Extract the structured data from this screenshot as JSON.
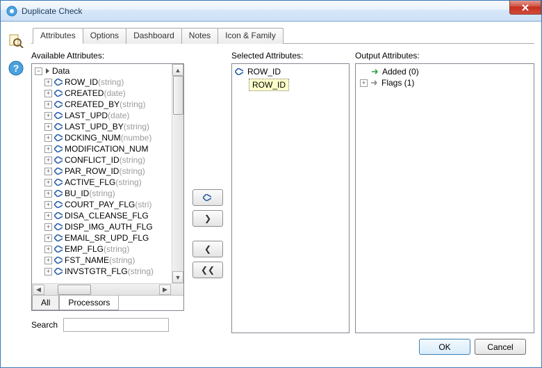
{
  "window": {
    "title": "Duplicate Check"
  },
  "tabs": [
    "Attributes",
    "Options",
    "Dashboard",
    "Notes",
    "Icon & Family"
  ],
  "active_tab": 0,
  "labels": {
    "available": "Available Attributes:",
    "selected": "Selected Attributes:",
    "output": "Output Attributes:",
    "search": "Search"
  },
  "tree_root": {
    "label": "Data"
  },
  "available_attributes": [
    {
      "name": "ROW_ID",
      "type": "string"
    },
    {
      "name": "CREATED",
      "type": "date"
    },
    {
      "name": "CREATED_BY",
      "type": "string"
    },
    {
      "name": "LAST_UPD",
      "type": "date"
    },
    {
      "name": "LAST_UPD_BY",
      "type": "string"
    },
    {
      "name": "DCKING_NUM",
      "type": "numbe"
    },
    {
      "name": "MODIFICATION_NUM",
      "type": ""
    },
    {
      "name": "CONFLICT_ID",
      "type": "string"
    },
    {
      "name": "PAR_ROW_ID",
      "type": "string"
    },
    {
      "name": "ACTIVE_FLG",
      "type": "string"
    },
    {
      "name": "BU_ID",
      "type": "string"
    },
    {
      "name": "COURT_PAY_FLG",
      "type": "stri"
    },
    {
      "name": "DISA_CLEANSE_FLG",
      "type": ""
    },
    {
      "name": "DISP_IMG_AUTH_FLG",
      "type": ""
    },
    {
      "name": "EMAIL_SR_UPD_FLG",
      "type": ""
    },
    {
      "name": "EMP_FLG",
      "type": "string"
    },
    {
      "name": "FST_NAME",
      "type": "string"
    },
    {
      "name": "INVSTGTR_FLG",
      "type": "string"
    }
  ],
  "bottom_tabs": {
    "all": "All",
    "processors": "Processors",
    "active": "processors"
  },
  "selected_attributes": [
    "ROW_ID"
  ],
  "drag_label": "ROW_ID",
  "output_groups": [
    {
      "label": "Added",
      "count": 0,
      "expanded": true,
      "color": "green"
    },
    {
      "label": "Flags",
      "count": 1,
      "expanded": false,
      "color": "gray"
    }
  ],
  "buttons": {
    "ok": "OK",
    "cancel": "Cancel"
  },
  "search_value": ""
}
